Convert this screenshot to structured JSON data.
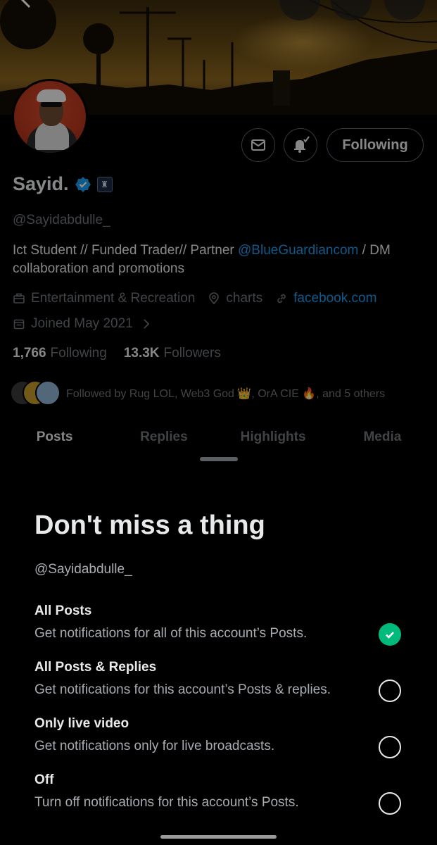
{
  "profile": {
    "name": "Sayid.",
    "handle": "@Sayidabdulle_",
    "bio_prefix": "Ict Student // Funded Trader// Partner ",
    "bio_link": "@BlueGuardiancom",
    "bio_suffix": " / DM collaboration and promotions",
    "category": "Entertainment & Recreation",
    "location": "charts",
    "website": "facebook.com",
    "joined": "Joined May 2021",
    "following_count": "1,766",
    "following_label": "Following",
    "followers_count": "13.3K",
    "followers_label": "Followers",
    "followed_by": "Followed by Rug LOL, Web3 God 👑, OrA CIE 🔥, and 5 others",
    "following_button": "Following"
  },
  "tabs": [
    {
      "label": "Posts",
      "active": true
    },
    {
      "label": "Replies",
      "active": false
    },
    {
      "label": "Highlights",
      "active": false
    },
    {
      "label": "Media",
      "active": false
    }
  ],
  "sheet": {
    "title": "Don't miss a thing",
    "handle": "@Sayidabdulle_",
    "options": [
      {
        "title": "All Posts",
        "desc": "Get notifications for all of this account’s Posts.",
        "selected": true
      },
      {
        "title": "All Posts & Replies",
        "desc": "Get notifications for this account’s Posts & replies.",
        "selected": false
      },
      {
        "title": "Only live video",
        "desc": "Get notifications only for live broadcasts.",
        "selected": false
      },
      {
        "title": "Off",
        "desc": "Turn off notifications for this account’s Posts.",
        "selected": false
      }
    ]
  },
  "colors": {
    "accent": "#1d9bf0",
    "selected": "#00ba7c",
    "background": "#000000"
  },
  "icons": [
    "back-icon",
    "history-icon",
    "search-icon",
    "more-icon",
    "mail-icon",
    "bell-check-icon",
    "verified-icon",
    "briefcase-icon",
    "location-icon",
    "link-icon",
    "calendar-icon",
    "chevron-right-icon",
    "check-icon"
  ]
}
